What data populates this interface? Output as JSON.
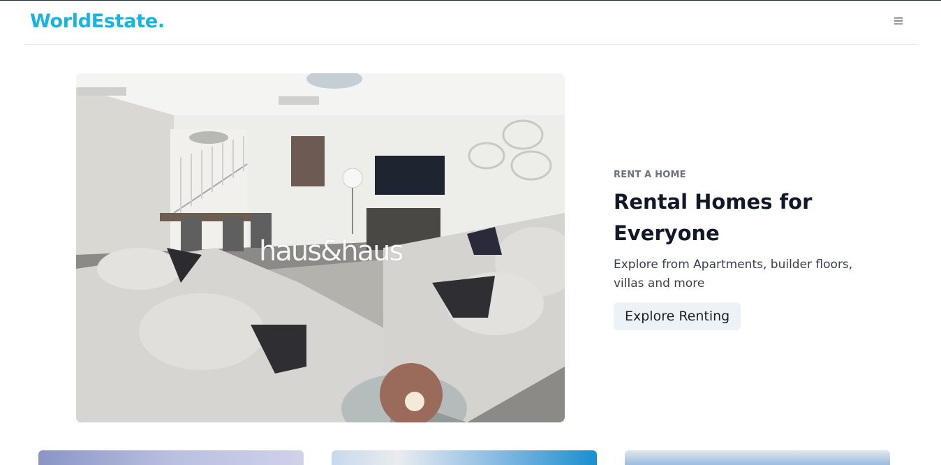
{
  "brand": {
    "name": "WorldEstate."
  },
  "nav": {
    "menu_icon": "hamburger-menu-icon"
  },
  "hero": {
    "image_watermark": "haus&haus",
    "eyebrow": "RENT A HOME",
    "title": "Rental Homes for Everyone",
    "description": "Explore from Apartments, builder floors, villas and more",
    "cta_label": "Explore Renting"
  },
  "colors": {
    "brand": "#17b5dd",
    "cta_bg": "#edf2f7",
    "eyebrow": "#6b7280"
  }
}
